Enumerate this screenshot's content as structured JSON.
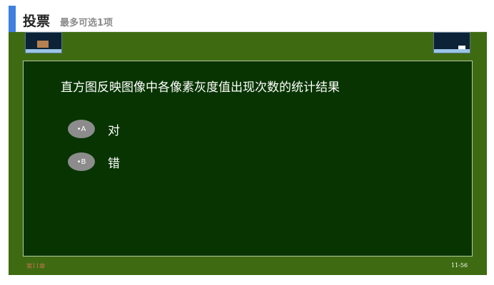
{
  "header": {
    "title": "投票",
    "subtitle": "最多可选1项"
  },
  "slide": {
    "question": "直方图反映图像中各像素灰度值出现次数的统计结果",
    "options": [
      {
        "badge": "•A",
        "label": "对"
      },
      {
        "badge": "•B",
        "label": "错"
      }
    ],
    "footer_left": "第11章",
    "footer_right": "11-56"
  },
  "colors": {
    "accent": "#3f7fe0",
    "slide_background": "#3e6b12",
    "board": "#073400",
    "badge": "#8c8c8c"
  }
}
